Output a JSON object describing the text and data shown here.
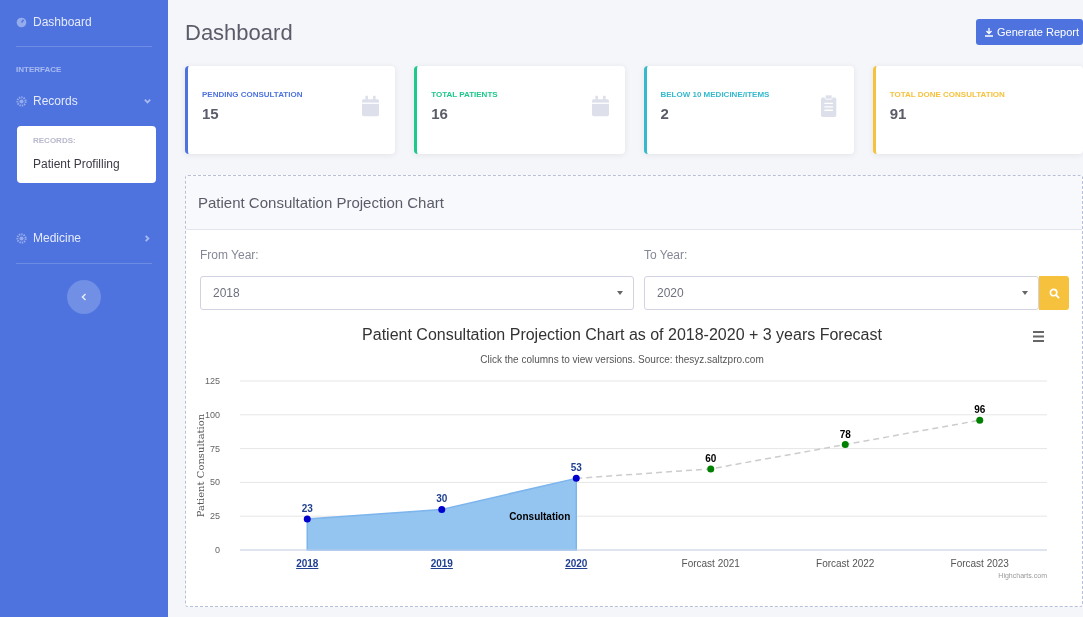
{
  "sidebar": {
    "items": [
      {
        "kind": "link",
        "label": "Dashboard"
      },
      {
        "kind": "heading",
        "label": "INTERFACE"
      },
      {
        "kind": "menu",
        "label": "Records",
        "expanded": true,
        "submenu": {
          "heading": "RECORDS:",
          "items": [
            "Patient Profilling"
          ]
        }
      },
      {
        "kind": "menu",
        "label": "Medicine",
        "expanded": false
      }
    ]
  },
  "page": {
    "title": "Dashboard",
    "button": "Generate Report"
  },
  "cards": [
    {
      "label": "PENDING CONSULTATION",
      "value": "15",
      "color": "#4e73df"
    },
    {
      "label": "TOTAL PATIENTS",
      "value": "16",
      "color": "#1cc88a"
    },
    {
      "label": "BELOW 10 MEDICINE/ITEMS",
      "value": "2",
      "color": "#36b9cc"
    },
    {
      "label": "TOTAL DONE CONSULTATION",
      "value": "91",
      "color": "#f6c23e"
    }
  ],
  "panel": {
    "title": "Patient Consultation Projection Chart",
    "from": {
      "label": "From Year:",
      "value": "2018"
    },
    "to": {
      "label": "To Year:",
      "value": "2020"
    },
    "credit": "Highcharts.com",
    "chart_data": {
      "type": "area",
      "title": "Patient Consultation Projection Chart as of 2018-2020 + 3 years Forecast",
      "subtitle": "Click the columns to view versions. Source: thesyz.saltzpro.com",
      "ylabel": "Patient Consultation",
      "categories": [
        "2018",
        "2019",
        "2020",
        "Forcast 2021",
        "Forcast 2022",
        "Forcast 2023"
      ],
      "ylim": [
        0,
        125
      ],
      "yticks": [
        0,
        25,
        50,
        75,
        100,
        125
      ],
      "grid": true,
      "series": [
        {
          "name": "Consultation",
          "type": "area",
          "line_style": "solid",
          "color": "#0000cc",
          "values": [
            23,
            30,
            53,
            null,
            null,
            null
          ],
          "value_labels": [
            "23",
            "30",
            "53",
            null,
            null,
            null
          ]
        },
        {
          "type": "line",
          "line_style": "dashed",
          "color": "#008000",
          "values": [
            null,
            null,
            53,
            60,
            78,
            96
          ],
          "value_labels": [
            null,
            null,
            null,
            "60",
            "78",
            "96"
          ]
        }
      ]
    }
  }
}
